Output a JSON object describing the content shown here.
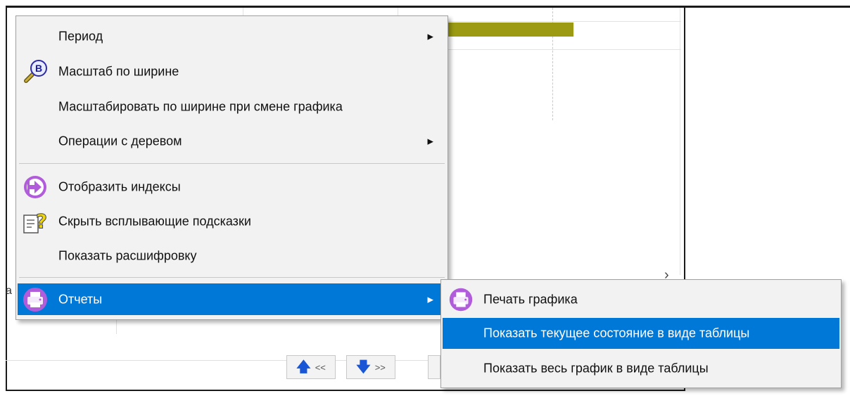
{
  "background": {
    "left_glyph": "a",
    "nav": {
      "prev_label": "<<",
      "next_label": ">>"
    },
    "bar_color": "#9b9a12"
  },
  "context_menu": {
    "items": [
      {
        "label": "Период",
        "submenu": true,
        "icon": null
      },
      {
        "label": "Масштаб по ширине",
        "submenu": false,
        "icon": "magnifier-b-icon"
      },
      {
        "label": "Масштабировать по ширине при смене графика",
        "submenu": false,
        "icon": null
      },
      {
        "label": "Операции с деревом",
        "submenu": true,
        "icon": null
      },
      {
        "label": "Отобразить индексы",
        "submenu": false,
        "icon": "arrow-circle-icon"
      },
      {
        "label": "Скрыть всплывающие подсказки",
        "submenu": false,
        "icon": "document-question-icon"
      },
      {
        "label": "Показать расшифровку",
        "submenu": false,
        "icon": null
      },
      {
        "label": "Отчеты",
        "submenu": true,
        "icon": "printer-icon",
        "active": true
      }
    ],
    "reports_submenu": {
      "items": [
        {
          "label": "Печать графика",
          "icon": "printer-icon"
        },
        {
          "label": "Показать текущее состояние в виде таблицы",
          "active": true
        },
        {
          "label": "Показать весь график в виде таблицы"
        }
      ]
    },
    "highlight_color": "#0078d7"
  }
}
